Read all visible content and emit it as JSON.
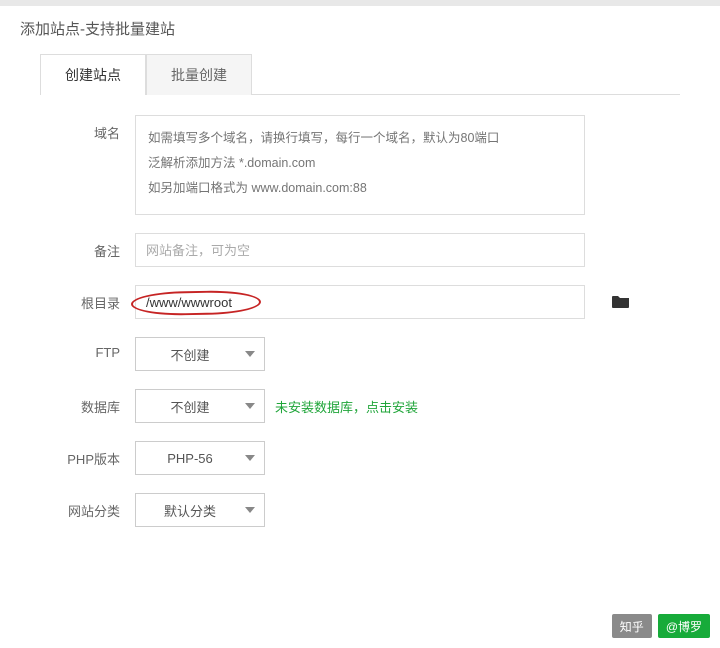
{
  "title": "添加站点-支持批量建站",
  "tabs": {
    "create": "创建站点",
    "batch": "批量创建"
  },
  "labels": {
    "domain": "域名",
    "remark": "备注",
    "rootdir": "根目录",
    "ftp": "FTP",
    "database": "数据库",
    "php": "PHP版本",
    "category": "网站分类"
  },
  "domain_placeholder": "如需填写多个域名，请换行填写，每行一个域名，默认为80端口\n泛解析添加方法 *.domain.com\n如另加端口格式为 www.domain.com:88",
  "remark_placeholder": "网站备注，可为空",
  "rootdir_value": "/www/wwwroot",
  "ftp_value": "不创建",
  "database_value": "不创建",
  "database_hint": "未安装数据库，点击安装",
  "php_value": "PHP-56",
  "category_value": "默认分类",
  "footer": {
    "brand": "知乎",
    "author": "@博罗"
  }
}
